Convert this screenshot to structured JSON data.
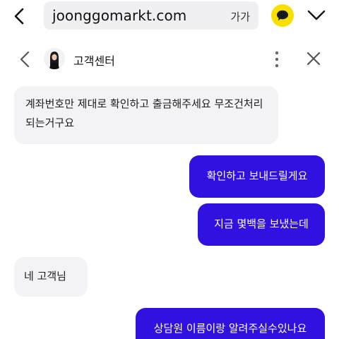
{
  "browser": {
    "url": "joonggomarkt.com",
    "text_size_label": "가가",
    "accent_kakao": "#f7df00"
  },
  "chat": {
    "title": "고객센터",
    "outgoing_color": "#2f12e0",
    "incoming_color": "#f3f3f5"
  },
  "messages": [
    {
      "side": "incoming",
      "text": "계좌번호만 제대로 확인하고 출금해주세요 무조건처리되는거구요"
    },
    {
      "side": "outgoing",
      "text": "확인하고 보내드릴게요"
    },
    {
      "side": "outgoing",
      "text": "지금 몇백을 보냈는데"
    },
    {
      "side": "incoming",
      "text": "네 고객님"
    },
    {
      "side": "outgoing",
      "text": "상담원 이름이랑 알려주실수있나요"
    }
  ],
  "icons": {
    "browser_back": "chevron-left-icon",
    "kakao": "kakao-talk-icon",
    "menu": "chevron-down-icon",
    "chat_back": "chevron-left-icon",
    "more": "more-vertical-icon",
    "close": "close-icon"
  }
}
